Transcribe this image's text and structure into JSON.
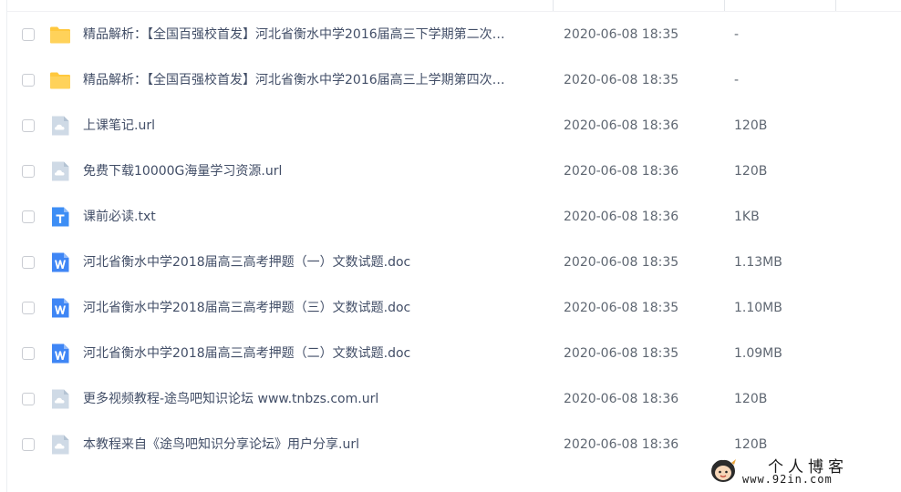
{
  "files": [
    {
      "icon": "folder-icon",
      "name": "精品解析：【全国百强校首发】河北省衡水中学2016届高三下学期第二次…",
      "date": "2020-06-08 18:35",
      "size": "-"
    },
    {
      "icon": "folder-icon",
      "name": "精品解析：【全国百强校首发】河北省衡水中学2016届高三上学期第四次…",
      "date": "2020-06-08 18:35",
      "size": "-"
    },
    {
      "icon": "url-file-icon",
      "name": "上课笔记.url",
      "date": "2020-06-08 18:36",
      "size": "120B"
    },
    {
      "icon": "url-file-icon",
      "name": "免费下载10000G海量学习资源.url",
      "date": "2020-06-08 18:36",
      "size": "120B"
    },
    {
      "icon": "txt-file-icon",
      "name": "课前必读.txt",
      "date": "2020-06-08 18:36",
      "size": "1KB"
    },
    {
      "icon": "word-doc-icon",
      "name": "河北省衡水中学2018届高三高考押题（一）文数试题.doc",
      "date": "2020-06-08 18:35",
      "size": "1.13MB"
    },
    {
      "icon": "word-doc-icon",
      "name": "河北省衡水中学2018届高三高考押题（三）文数试题.doc",
      "date": "2020-06-08 18:35",
      "size": "1.10MB"
    },
    {
      "icon": "word-doc-icon",
      "name": "河北省衡水中学2018届高三高考押题（二）文数试题.doc",
      "date": "2020-06-08 18:35",
      "size": "1.09MB"
    },
    {
      "icon": "url-file-icon",
      "name": "更多视频教程-途鸟吧知识论坛 www.tnbzs.com.url",
      "date": "2020-06-08 18:36",
      "size": "120B"
    },
    {
      "icon": "url-file-icon",
      "name": "本教程来自《途鸟吧知识分享论坛》用户分享.url",
      "date": "2020-06-08 18:36",
      "size": "120B"
    }
  ],
  "watermark": {
    "title": "个人博客",
    "url": "www.92in.com"
  },
  "colors": {
    "folder": "#ffc83d",
    "url_file": "#cfdae6",
    "txt_file": "#3d8ef5",
    "word_doc": "#3f86f5",
    "filename_text": "#424e67",
    "meta_text": "#5f6772"
  }
}
